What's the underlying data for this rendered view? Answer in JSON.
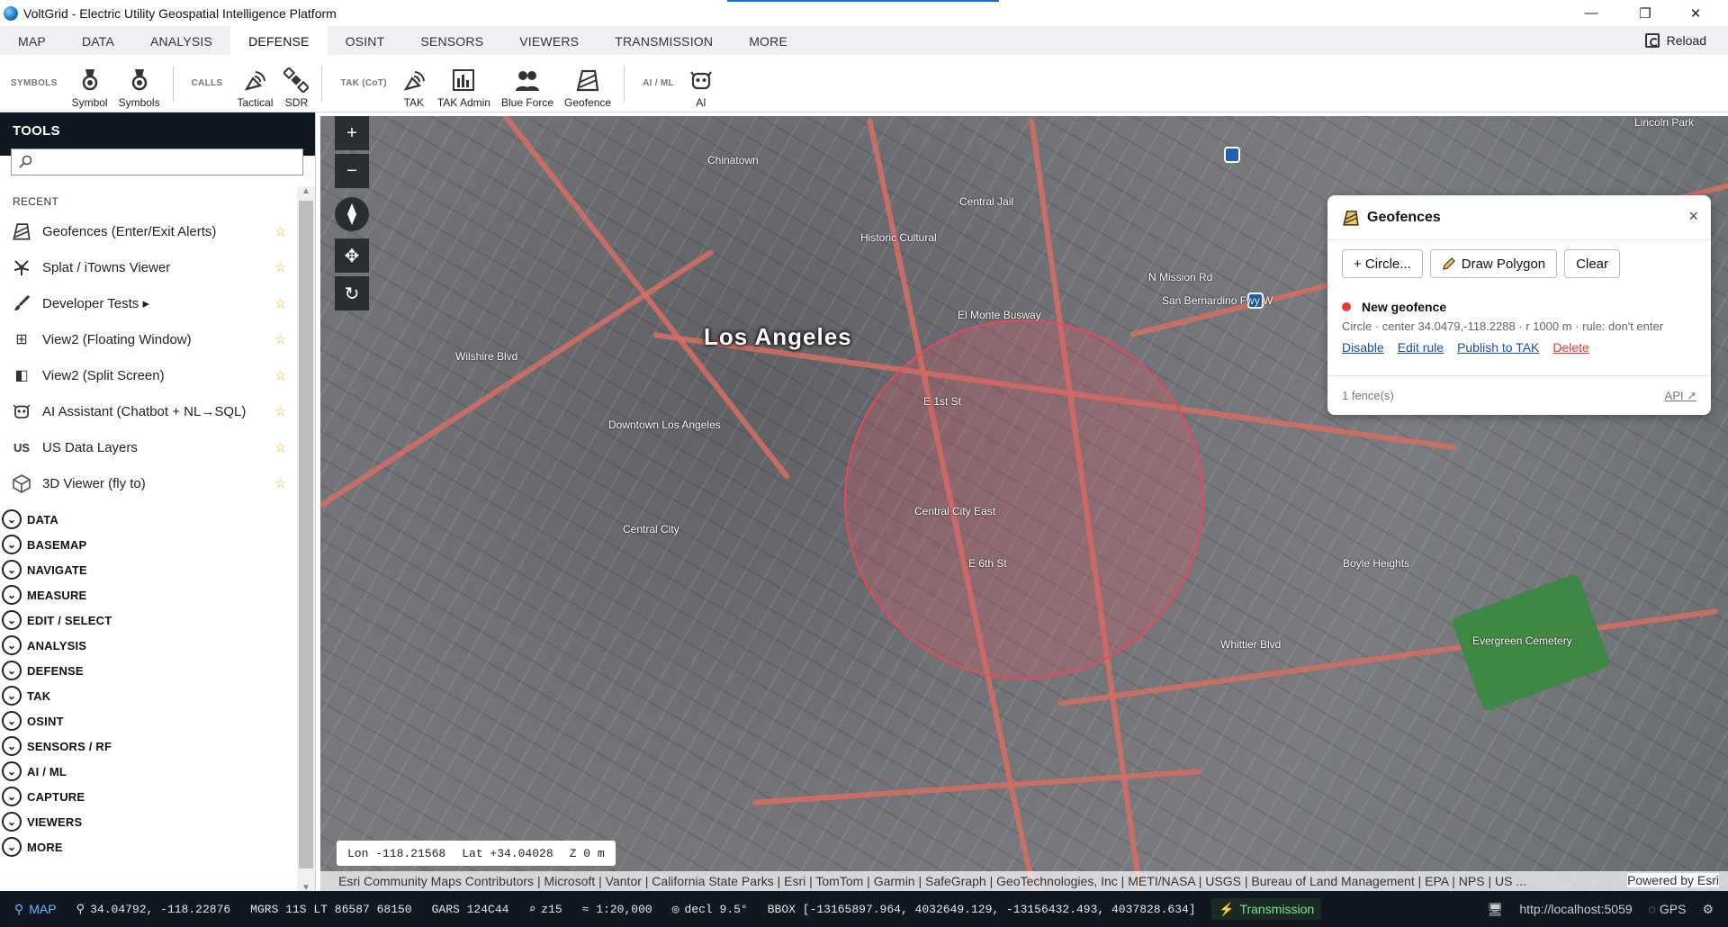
{
  "window": {
    "title": "VoltGrid - Electric Utility Geospatial Intelligence Platform",
    "minimize": "—",
    "restore": "❐",
    "close": "✕"
  },
  "menu": {
    "tabs": [
      "MAP",
      "DATA",
      "ANALYSIS",
      "DEFENSE",
      "OSINT",
      "SENSORS",
      "VIEWERS",
      "TRANSMISSION",
      "MORE"
    ],
    "active": "DEFENSE",
    "reload": "Reload"
  },
  "ribbon": {
    "groups": [
      {
        "label": "SYMBOLS",
        "buttons": [
          "Symbol",
          "Symbols"
        ]
      },
      {
        "label": "CALLS",
        "buttons": [
          "Tactical",
          "SDR"
        ]
      },
      {
        "label": "TAK (CoT)",
        "buttons": [
          "TAK",
          "TAK Admin",
          "Blue Force",
          "Geofence"
        ]
      },
      {
        "label": "AI / ML",
        "buttons": [
          "AI"
        ]
      }
    ]
  },
  "tools": {
    "title": "TOOLS",
    "search_placeholder": "",
    "recent_label": "RECENT",
    "recent": [
      {
        "label": "Geofences (Enter/Exit Alerts)",
        "icon": "geofence-icon"
      },
      {
        "label": "Splat / iTowns Viewer",
        "icon": "splat-icon"
      },
      {
        "label": "Developer Tests ▸",
        "icon": "brush-icon"
      },
      {
        "label": "View2 (Floating Window)",
        "icon": "grid-icon"
      },
      {
        "label": "View2 (Split Screen)",
        "icon": "split-icon"
      },
      {
        "label": "AI Assistant (Chatbot + NL→SQL)",
        "icon": "robot-icon"
      },
      {
        "label": "US Data Layers",
        "icon": "us-icon"
      },
      {
        "label": "3D Viewer (fly to)",
        "icon": "cube-icon"
      }
    ],
    "categories": [
      "DATA",
      "BASEMAP",
      "NAVIGATE",
      "MEASURE",
      "EDIT / SELECT",
      "ANALYSIS",
      "DEFENSE",
      "TAK",
      "OSINT",
      "SENSORS / RF",
      "AI / ML",
      "CAPTURE",
      "VIEWERS",
      "MORE"
    ]
  },
  "map": {
    "city": "Los Angeles",
    "labels": [
      "Chinatown",
      "Central Jail",
      "Historic Cultural",
      "Downtown Los Angeles",
      "Central City",
      "Central City East",
      "Boyle Heights",
      "Evergreen Cemetery",
      "Lincoln Park",
      "El Monte Busway",
      "E 1st St",
      "E 6th St",
      "N Mission Rd",
      "San Bernardino Fwy W",
      "Wilshire Blvd",
      "Whittier Blvd"
    ],
    "coords": {
      "lon": "Lon -118.21568",
      "lat": "Lat +34.04028",
      "z": "Z 0 m"
    },
    "attribution": "Esri Community Maps Contributors | Microsoft | Vantor | California State Parks | Esri | TomTom | Garmin | SafeGraph | GeoTechnologies, Inc | METI/NASA | USGS | Bureau of Land Management | EPA | NPS | US ...",
    "powered": "Powered by Esri"
  },
  "geofences": {
    "title": "Geofences",
    "close": "×",
    "buttons": {
      "circle": "+ Circle...",
      "polygon": "Draw Polygon",
      "clear": "Clear"
    },
    "fence": {
      "name": "New geofence",
      "desc": "Circle · center 34.0479,-118.2288 · r 1000 m · rule: don't enter",
      "links": {
        "disable": "Disable",
        "edit": "Edit rule",
        "publish": "Publish to TAK",
        "delete": "Delete"
      },
      "status_color": "#e53935"
    },
    "count": "1 fence(s)",
    "api": "API ↗"
  },
  "status": {
    "mode": "MAP",
    "latlon": "34.04792, -118.22876",
    "mgrs": "MGRS 11S LT 86587 68150",
    "gars": "GARS 124C44",
    "zoom": "z15",
    "scale": "≈ 1:20,000",
    "decl": "decl 9.5°",
    "bbox": "BBOX [-13165897.964, 4032649.129, -13156432.493, 4037828.634]",
    "transmission": "Transmission",
    "host": "http://localhost:5059",
    "gps": "GPS"
  },
  "colors": {
    "accent": "#1b6fd0",
    "dark": "#0f1720",
    "geofence": "#e34a5b",
    "link": "#1b4fa8"
  }
}
